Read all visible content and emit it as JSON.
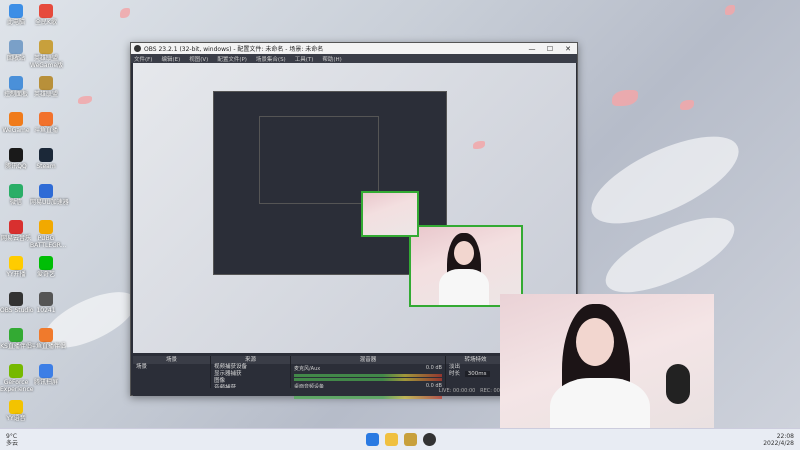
{
  "desktop": {
    "icons": [
      {
        "label": "此电脑",
        "color": "#3c8ee6"
      },
      {
        "label": "全民K歌",
        "color": "#e64a3c"
      },
      {
        "label": "回收站",
        "color": "#7aa0c8"
      },
      {
        "label": "英雄联盟\nWeGame版",
        "color": "#c8a03c"
      },
      {
        "label": "控制面板",
        "color": "#4a90d9"
      },
      {
        "label": "英雄联盟",
        "color": "#b8903a"
      },
      {
        "label": "WeGame",
        "color": "#f07b1a"
      },
      {
        "label": "斗鱼直播",
        "color": "#f2722c"
      },
      {
        "label": "腾讯QQ",
        "color": "#1a1a1a"
      },
      {
        "label": "Steam",
        "color": "#1b2838"
      },
      {
        "label": "微信",
        "color": "#2aae67"
      },
      {
        "label": "网易UU加速器",
        "color": "#2e6bd6"
      },
      {
        "label": "网易云音乐",
        "color": "#d8302f"
      },
      {
        "label": "PUBG\nBATTLEGR...",
        "color": "#f2a900"
      },
      {
        "label": "YY开播",
        "color": "#ffcc00"
      },
      {
        "label": "爱奇艺",
        "color": "#00be06"
      },
      {
        "label": "OBS Studio",
        "color": "#333"
      },
      {
        "label": "10241",
        "color": "#555"
      },
      {
        "label": "KS直播伴侣",
        "color": "#33aa33"
      },
      {
        "label": "斗鱼直播伴侣",
        "color": "#f07a2c"
      },
      {
        "label": "GeForce\nExperience",
        "color": "#76b900"
      },
      {
        "label": "腾讯扫屏",
        "color": "#3c7ee6"
      },
      {
        "label": "YY语音",
        "color": "#f3c300"
      }
    ]
  },
  "obs": {
    "title": "OBS 23.2.1 (32-bit, windows) - 配置文件: 未命名 - 场景: 未命名",
    "menu": [
      "文件(F)",
      "编辑(E)",
      "视图(V)",
      "配置文件(P)",
      "场景集合(S)",
      "工具(T)",
      "帮助(H)"
    ],
    "docks": {
      "scenes": {
        "title": "场景",
        "items": [
          "场景"
        ]
      },
      "sources": {
        "title": "来源",
        "items": [
          "视频捕获设备",
          "显示器捕获",
          "图像",
          "音频捕获"
        ]
      },
      "mixer": {
        "title": "混音器",
        "channels": [
          {
            "name": "麦克风/Aux",
            "db": "0.0 dB"
          },
          {
            "name": "桌面音频设备",
            "db": "0.0 dB"
          }
        ]
      },
      "transitions": {
        "title": "转场特效",
        "fade": "淡出",
        "duration_label": "时长",
        "duration": "300ms"
      }
    },
    "status": {
      "live": "LIVE: 00:00:00",
      "rec": "REC: 00:00:00"
    }
  },
  "taskbar": {
    "weather": "9°C\n多云",
    "tray_time": "22:08",
    "tray_date": "2022/4/28"
  }
}
